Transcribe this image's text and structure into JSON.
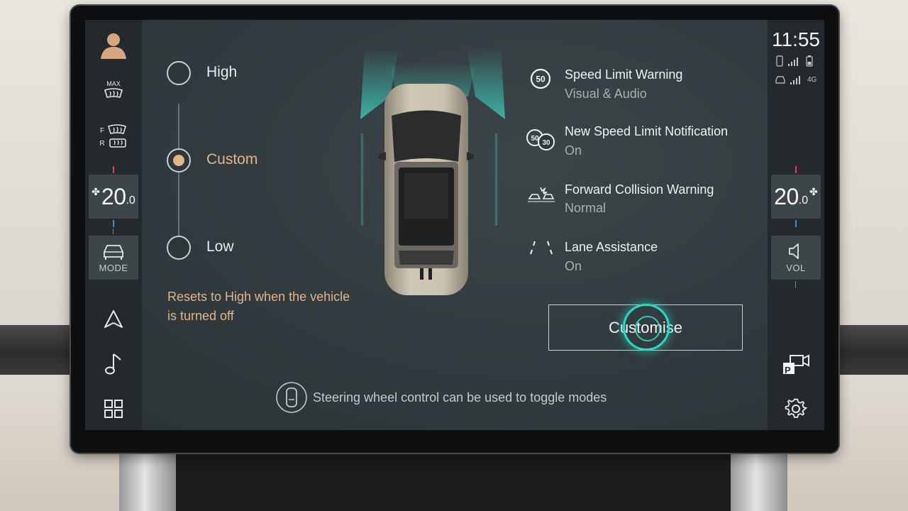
{
  "status": {
    "time": "11:55",
    "network": "4G"
  },
  "left_rail": {
    "defrost_rear_label": "MAX",
    "defrost_front_label": "F",
    "defrost_rear2_label": "R",
    "temp_value": "20",
    "temp_decimal": ".0",
    "mode_label": "MODE"
  },
  "right_rail": {
    "temp_value": "20",
    "temp_decimal": ".0",
    "vol_label": "VOL",
    "park_label": "P"
  },
  "sensitivity": {
    "options": [
      {
        "label": "High",
        "selected": false
      },
      {
        "label": "Custom",
        "selected": true
      },
      {
        "label": "Low",
        "selected": false
      }
    ],
    "note_line1": "Resets to High when the vehicle",
    "note_line2": "is turned off"
  },
  "features": [
    {
      "title": "Speed Limit Warning",
      "value": "Visual & Audio",
      "icon": "speed-limit-icon",
      "icon_text": "50"
    },
    {
      "title": "New Speed Limit Notification",
      "value": "On",
      "icon": "speed-limit-change-icon",
      "icon_text_a": "50",
      "icon_text_b": "30"
    },
    {
      "title": "Forward Collision Warning",
      "value": "Normal",
      "icon": "collision-warning-icon"
    },
    {
      "title": "Lane Assistance",
      "value": "On",
      "icon": "lane-assist-icon"
    }
  ],
  "customise_label": "Customise",
  "hint_text": "Steering wheel control can be used to toggle modes",
  "colors": {
    "accent": "#e2b48a",
    "touch": "#27d9c6"
  }
}
